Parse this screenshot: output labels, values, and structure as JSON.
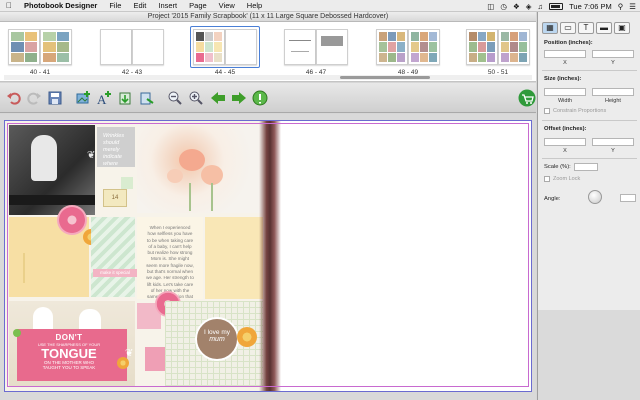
{
  "menubar": {
    "apple": "",
    "app_name": "Photobook Designer",
    "items": [
      "File",
      "Edit",
      "Insert",
      "Page",
      "View",
      "Help"
    ],
    "clock": "Tue 7:06 PM"
  },
  "window": {
    "title": "Project '2015 Family Scrapbook' (11 x 11 Large Square Debossed Hardcover)"
  },
  "thumbnails": [
    {
      "label": "40 - 41",
      "selected": false
    },
    {
      "label": "42 - 43",
      "selected": false
    },
    {
      "label": "44 - 45",
      "selected": true
    },
    {
      "label": "46 - 47",
      "selected": false
    },
    {
      "label": "48 - 49",
      "selected": false
    },
    {
      "label": "50 - 51",
      "selected": false
    }
  ],
  "toolbar": {
    "tools": [
      "undo",
      "redo",
      "save",
      "add-photo",
      "add-text",
      "insert-page",
      "page-tool",
      "zoom-out",
      "zoom-in",
      "previous-page",
      "next-page",
      "help",
      "cart"
    ]
  },
  "layout": {
    "quote_text": "Wrinkles should merely indicate where smiles have been.",
    "journal_text": "When I experienced how selfless you have to be when taking care of a baby, I can't help but realize how strong Mom is. She might seem more fragile now, but that's normal when we age. Her strength to lift kids. Let's take care of her now with the same compassion that she showed us when we were little. 2015",
    "sticker_note": "make it special",
    "tongue_lines": [
      "DON'T",
      "USE THE SHARPNESS OF YOUR",
      "TONGUE",
      "ON THE MOTHER WHO",
      "TAUGHT YOU TO SPEAK"
    ],
    "badge_text": "I love my",
    "badge_script": "mum",
    "tag_text": "14"
  },
  "panel": {
    "position_label": "Position (inches):",
    "x_label": "X",
    "y_label": "Y",
    "size_label": "Size (inches):",
    "width_label": "Width",
    "height_label": "Height",
    "constrain_label": "Constrain Proportions",
    "offset_label": "Offset (inches):",
    "offset_x_label": "X",
    "offset_y_label": "Y",
    "scale_label": "Scale (%):",
    "zoom_lock_label": "Zoom Lock",
    "angle_label": "Angle:"
  },
  "colors": {
    "accent": "#4a7fd6",
    "cart": "#2f9a3a",
    "arrow": "#3e9e2a",
    "pink": "#e96a8f",
    "yellow": "#f7dfa4"
  }
}
